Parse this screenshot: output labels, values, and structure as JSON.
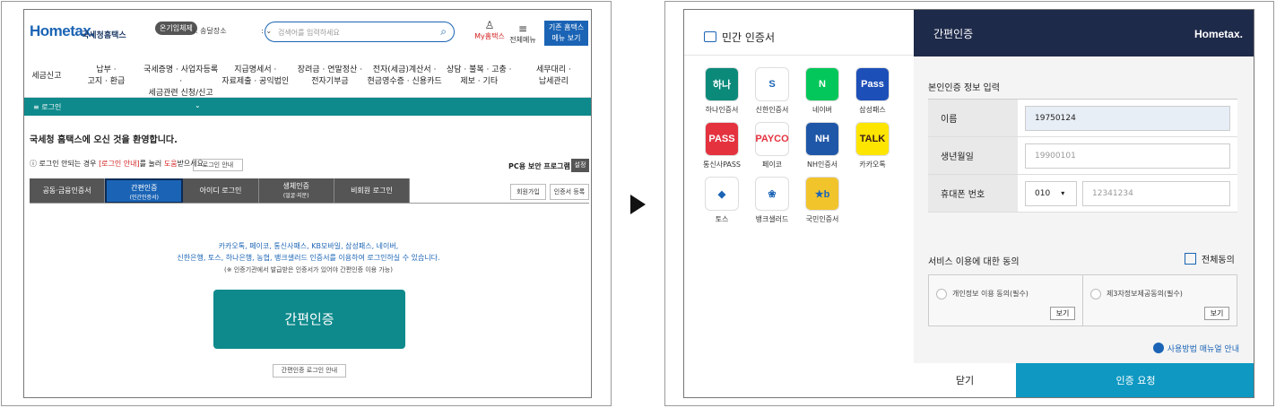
{
  "hometax": {
    "logo": "Hometax.",
    "logo_sub": "국세청홈택스",
    "badge": "온기임체제",
    "location_select": "3. 송달장소",
    "search_placeholder": "검색어를 입력하세요",
    "my_label": "My홈택스",
    "menu_label": "전체메뉴",
    "old_button": "기존 홈택스\n메뉴 보기",
    "gnb": [
      "세금신고",
      "납부 ·\n고지 · 환급",
      "국세증명 · 사업자등록 ·\n세금관련 신청/신고",
      "지급명세서 ·\n자료제출 · 공익법인",
      "장려금 · 연말정산 ·\n전자기부금",
      "전자(세금)계산서 ·\n현금영수증 · 신용카드",
      "상담 · 불복 · 고충 ·\n제보 · 기타",
      "세무대리 ·\n납세관리"
    ],
    "login_bar": "≡  로그인",
    "login_caret": "⌄",
    "welcome": "국세청 홈택스에 오신 것을 환영합니다.",
    "guide_pre": "ⓘ 로그인 안되는 경우 ",
    "guide_link": "[로그인 안내]",
    "guide_mid": "를 눌러 ",
    "guide_help": "도움",
    "guide_post": "받으세요.",
    "guide_button": "로그인 안내",
    "pc_security": "PC용 보안 프로그램",
    "pc_button": "설정",
    "tabs": [
      {
        "label": "공동·금융인증서",
        "sub": ""
      },
      {
        "label": "간편인증",
        "sub": "(민간인증서)"
      },
      {
        "label": "아이디 로그인",
        "sub": ""
      },
      {
        "label": "생체인증",
        "sub": "(얼굴·지문)"
      },
      {
        "label": "비회원 로그인",
        "sub": ""
      }
    ],
    "join_button": "회원가입",
    "cert_button": "인증서 등록",
    "providers_line1": "카카오톡, 페이코, 통신사패스, KB모바일, 삼성패스, 네이버,",
    "providers_line2": "신한은행, 토스, 하나은행, 농협, 뱅크샐러드 인증서를 이용하여 로그인하실 수 있습니다.",
    "note": "(※ 인증기관에서 발급받은 인증서가 있어야 간편인증 이용 가능)",
    "simple_auth_button": "간편인증",
    "simple_guide_button": "간편인증 로그인 안내"
  },
  "auth": {
    "left_title": "민간 인증서",
    "apps": [
      {
        "label": "하나인증서",
        "icon": "하나",
        "color": "#0b8a7a"
      },
      {
        "label": "신한인증서",
        "icon": "S",
        "color": "#ffffff"
      },
      {
        "label": "네이버",
        "icon": "N",
        "color": "#03c75a"
      },
      {
        "label": "삼성패스",
        "icon": "Pass",
        "color": "#1d4fb8"
      },
      {
        "label": "통신사PASS",
        "icon": "PASS",
        "color": "#e4323f"
      },
      {
        "label": "페이코",
        "icon": "PAYCO",
        "color": "#ffffff"
      },
      {
        "label": "NH인증서",
        "icon": "NH",
        "color": "#1f57a8"
      },
      {
        "label": "카카오톡",
        "icon": "TALK",
        "color": "#fee500"
      },
      {
        "label": "토스",
        "icon": "◆",
        "color": "#ffffff"
      },
      {
        "label": "뱅크샐러드",
        "icon": "❀",
        "color": "#ffffff"
      },
      {
        "label": "국민인증서",
        "icon": "★b",
        "color": "#f2c42c"
      }
    ],
    "header_title": "간편인증",
    "header_logo": "Hometax.",
    "section_title": "본인인증 정보 입력",
    "name_label": "이름",
    "name_value": "19750124",
    "birth_label": "생년월일",
    "birth_placeholder": "19900101",
    "phone_label": "휴대폰 번호",
    "phone_prefix": "010",
    "phone_placeholder": "12341234",
    "agree_title": "서비스 이용에 대한 동의",
    "agree_all": "전체동의",
    "agree_items": [
      {
        "label": "개인정보 이용 동의(필수)",
        "view": "보기"
      },
      {
        "label": "제3자정보제공동의(필수)",
        "view": "보기"
      }
    ],
    "manual_link": "사용방법 매뉴얼 안내",
    "close_button": "닫기",
    "request_button": "인증 요청"
  }
}
